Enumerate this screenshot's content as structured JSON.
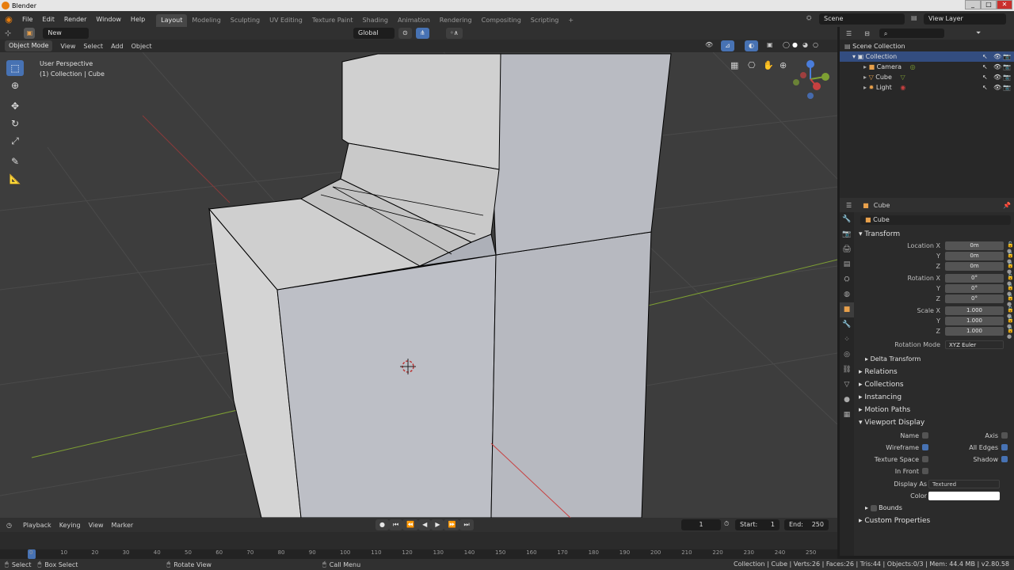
{
  "window": {
    "title": "Blender",
    "min": "_",
    "max": "□",
    "close": "✕"
  },
  "menu": [
    "File",
    "Edit",
    "Render",
    "Window",
    "Help"
  ],
  "workspaces": [
    "Layout",
    "Modeling",
    "Sculpting",
    "UV Editing",
    "Texture Paint",
    "Shading",
    "Animation",
    "Rendering",
    "Compositing",
    "Scripting",
    "+"
  ],
  "scene": {
    "name": "Scene",
    "view_layer": "View Layer"
  },
  "header": {
    "new_label": "New",
    "orientation": "Global"
  },
  "viewport_header": {
    "mode": "Object Mode",
    "menus": [
      "View",
      "Select",
      "Add",
      "Object"
    ]
  },
  "viewport": {
    "perspective": "User Perspective",
    "collection": "(1) Collection | Cube"
  },
  "outliner": {
    "root": "Scene Collection",
    "collection": "Collection",
    "items": [
      {
        "label": "Camera"
      },
      {
        "label": "Cube"
      },
      {
        "label": "Light"
      }
    ]
  },
  "properties": {
    "object_name": "Cube",
    "data_name": "Cube",
    "transform_label": "Transform",
    "location_label": "Location X",
    "rotation_label": "Rotation X",
    "scale_label": "Scale X",
    "y": "Y",
    "z": "Z",
    "location": [
      "0m",
      "0m",
      "0m"
    ],
    "rotation": [
      "0°",
      "0°",
      "0°"
    ],
    "scale": [
      "1.000",
      "1.000",
      "1.000"
    ],
    "rotation_mode_label": "Rotation Mode",
    "rotation_mode": "XYZ Euler",
    "delta": "Delta Transform",
    "panels": [
      "Relations",
      "Collections",
      "Instancing",
      "Motion Paths"
    ],
    "viewport_display": "Viewport Display",
    "name": "Name",
    "axis": "Axis",
    "wireframe": "Wireframe",
    "all_edges": "All Edges",
    "texture_space": "Texture Space",
    "shadow": "Shadow",
    "in_front": "In Front",
    "display_as_label": "Display As",
    "display_as": "Textured",
    "color_label": "Color",
    "bounds": "Bounds",
    "custom": "Custom Properties"
  },
  "timeline": {
    "menus": [
      "Playback",
      "Keying",
      "View",
      "Marker"
    ],
    "current_frame": "1",
    "start_label": "Start:",
    "start": "1",
    "end_label": "End:",
    "end": "250",
    "ticks": [
      "0",
      "10",
      "20",
      "30",
      "40",
      "50",
      "60",
      "70",
      "80",
      "90",
      "100",
      "110",
      "120",
      "130",
      "140",
      "150",
      "160",
      "170",
      "180",
      "190",
      "200",
      "210",
      "220",
      "230",
      "240",
      "250"
    ]
  },
  "status": {
    "select": "Select",
    "box_select": "Box Select",
    "rotate_view": "Rotate View",
    "call_menu": "Call Menu",
    "stats": "Collection | Cube | Verts:26 | Faces:26 | Tris:44 | Objects:0/3 | Mem: 44.4 MB | v2.80.58"
  },
  "colors": {
    "accent": "#4772b3",
    "selected": "#e8a04b",
    "x_axis": "#b5424a",
    "y_axis": "#7ea033"
  }
}
